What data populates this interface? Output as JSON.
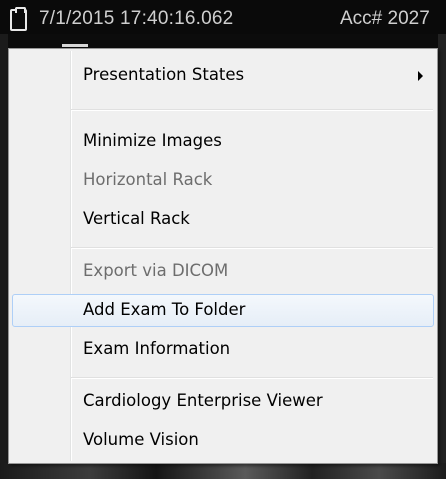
{
  "header": {
    "study_datetime": "7/1/2015 17:40:16.062",
    "accession": "Acc# 2027"
  },
  "context_menu": {
    "items": [
      {
        "label": "Presentation States",
        "enabled": true,
        "has_submenu": true
      },
      {
        "label": "Minimize Images",
        "enabled": true
      },
      {
        "label": "Horizontal Rack",
        "enabled": false
      },
      {
        "label": "Vertical Rack",
        "enabled": true
      },
      {
        "label": "Export via DICOM",
        "enabled": false
      },
      {
        "label": "Add Exam To Folder",
        "enabled": true,
        "highlighted": true
      },
      {
        "label": "Exam Information",
        "enabled": true
      },
      {
        "label": "Cardiology Enterprise Viewer",
        "enabled": true
      },
      {
        "label": "Volume Vision",
        "enabled": true
      }
    ]
  },
  "colors": {
    "menu_background": "#f0f0f0",
    "menu_border": "#979797",
    "hover_border": "#aecff7",
    "disabled_text": "#6d6d6d",
    "viewer_background": "#0c0c0c",
    "header_text": "#cfcfcf"
  },
  "icons": {
    "series_select": "checkbox-icon",
    "submenu": "triangle-right-icon"
  }
}
